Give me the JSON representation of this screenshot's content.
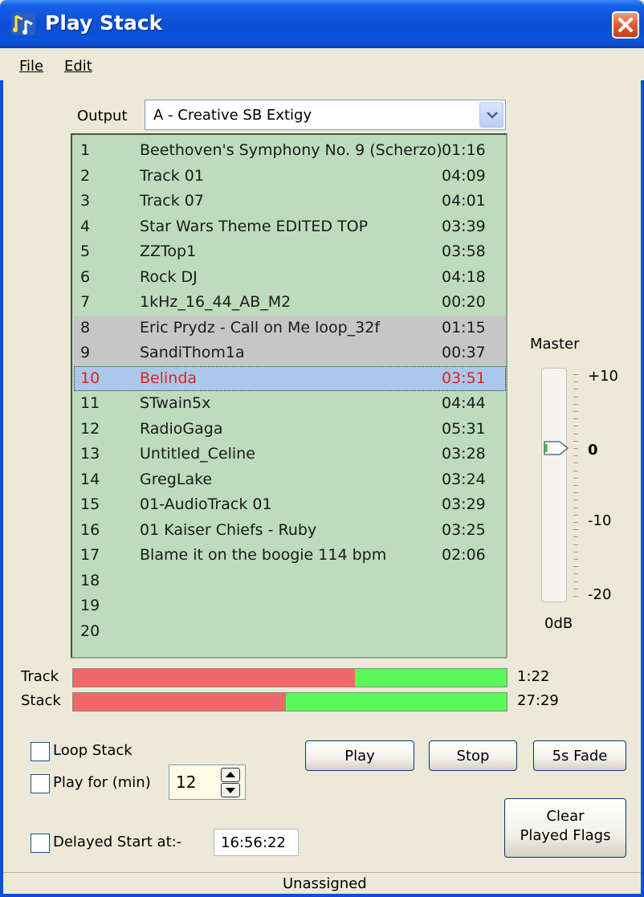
{
  "window": {
    "title": "Play Stack"
  },
  "menu": [
    {
      "label": "File"
    },
    {
      "label": "Edit"
    }
  ],
  "output": {
    "label": "Output",
    "selected": "A - Creative SB Extigy"
  },
  "tracks": [
    {
      "num": "1",
      "name": "Beethoven's Symphony No. 9 (Scherzo)",
      "duration": "01:16",
      "state": "normal"
    },
    {
      "num": "2",
      "name": "Track 01",
      "duration": "04:09",
      "state": "normal"
    },
    {
      "num": "3",
      "name": "Track 07",
      "duration": "04:01",
      "state": "normal"
    },
    {
      "num": "4",
      "name": "Star Wars Theme EDITED TOP",
      "duration": "03:39",
      "state": "normal"
    },
    {
      "num": "5",
      "name": "ZZTop1",
      "duration": "03:58",
      "state": "normal"
    },
    {
      "num": "6",
      "name": "Rock DJ",
      "duration": "04:18",
      "state": "normal"
    },
    {
      "num": "7",
      "name": "1kHz_16_44_AB_M2",
      "duration": "00:20",
      "state": "normal"
    },
    {
      "num": "8",
      "name": "Eric Prydz - Call on Me loop_32f",
      "duration": "01:15",
      "state": "played"
    },
    {
      "num": "9",
      "name": "SandiThom1a",
      "duration": "00:37",
      "state": "played"
    },
    {
      "num": "10",
      "name": "Belinda",
      "duration": "03:51",
      "state": "current"
    },
    {
      "num": "11",
      "name": "STwain5x",
      "duration": "04:44",
      "state": "normal"
    },
    {
      "num": "12",
      "name": "RadioGaga",
      "duration": "05:31",
      "state": "normal"
    },
    {
      "num": "13",
      "name": "Untitled_Celine",
      "duration": "03:28",
      "state": "normal"
    },
    {
      "num": "14",
      "name": "GregLake",
      "duration": "03:24",
      "state": "normal"
    },
    {
      "num": "15",
      "name": "01-AudioTrack 01",
      "duration": "03:29",
      "state": "normal"
    },
    {
      "num": "16",
      "name": "01  Kaiser Chiefs - Ruby",
      "duration": "03:25",
      "state": "normal"
    },
    {
      "num": "17",
      "name": "Blame it on the boogie 114 bpm",
      "duration": "02:06",
      "state": "normal"
    },
    {
      "num": "18",
      "name": "",
      "duration": "",
      "state": "normal"
    },
    {
      "num": "19",
      "name": "",
      "duration": "",
      "state": "normal"
    },
    {
      "num": "20",
      "name": "",
      "duration": "",
      "state": "normal"
    }
  ],
  "master": {
    "label": "Master",
    "scale": [
      "+10",
      "0",
      "-10",
      "-20"
    ],
    "readout": "0dB",
    "level_db": 0
  },
  "progress": {
    "track": {
      "label": "Track",
      "time": "1:22",
      "fraction": 0.65
    },
    "stack": {
      "label": "Stack",
      "time": "27:29",
      "fraction": 0.49
    }
  },
  "options": {
    "loop_stack": {
      "label": "Loop Stack",
      "checked": false
    },
    "play_for": {
      "label": "Play for (min)",
      "checked": false,
      "value": "12"
    },
    "delayed_start": {
      "label": "Delayed Start at:-",
      "checked": false,
      "time": "16:56:22"
    }
  },
  "buttons": {
    "play": "Play",
    "stop": "Stop",
    "fade": "5s Fade",
    "clear_line1": "Clear",
    "clear_line2": "Played Flags"
  },
  "status": {
    "text": "Unassigned"
  },
  "colors": {
    "list_bg": "#bddbbd",
    "played_row": "#c6c6c6",
    "current_row": "#a9c8ea",
    "current_text": "#e52020",
    "progress_played": "#f26767",
    "progress_remaining": "#5bfa5b"
  }
}
